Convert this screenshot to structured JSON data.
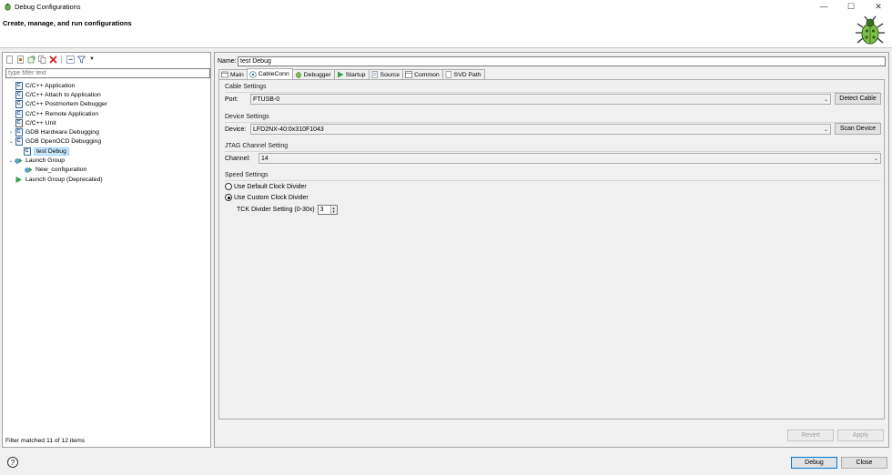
{
  "window": {
    "title": "Debug Configurations",
    "minimize": "—",
    "maximize": "☐",
    "close": "✕"
  },
  "header": {
    "subtitle": "Create, manage, and run configurations",
    "icon": "bug-icon"
  },
  "left": {
    "filter_placeholder": "type filter text",
    "tree": [
      {
        "label": "C/C++ Application",
        "icon": "c-app-icon",
        "level": 0
      },
      {
        "label": "C/C++ Attach to Application",
        "icon": "c-app-icon",
        "level": 0
      },
      {
        "label": "C/C++ Postmortem Debugger",
        "icon": "c-app-icon",
        "level": 0
      },
      {
        "label": "C/C++ Remote Application",
        "icon": "c-app-icon",
        "level": 0
      },
      {
        "label": "C/C++ Unit",
        "icon": "c-unit-icon",
        "level": 0
      },
      {
        "label": "GDB Hardware Debugging",
        "icon": "c-app-icon",
        "level": 0
      },
      {
        "label": "GDB OpenOCD Debugging",
        "icon": "c-app-icon",
        "level": 0
      },
      {
        "label": "test Debug",
        "icon": "c-app-icon",
        "level": 1
      },
      {
        "label": "Launch Group",
        "icon": "launch-group-icon",
        "level": 0
      },
      {
        "label": "New_configuration",
        "icon": "launch-config-icon",
        "level": 1
      },
      {
        "label": "Launch Group (Deprecated)",
        "icon": "run-icon",
        "level": 0
      }
    ],
    "status": "Filter matched 11 of 12 items"
  },
  "right": {
    "name_label": "Name:",
    "name_value": "test Debug",
    "tabs": [
      {
        "label": "Main",
        "icon": "main-tab-icon"
      },
      {
        "label": "CableConn",
        "icon": "cable-tab-icon"
      },
      {
        "label": "Debugger",
        "icon": "debugger-tab-icon"
      },
      {
        "label": "Startup",
        "icon": "startup-tab-icon"
      },
      {
        "label": "Source",
        "icon": "source-tab-icon"
      },
      {
        "label": "Common",
        "icon": "common-tab-icon"
      },
      {
        "label": "SVD Path",
        "icon": "svd-tab-icon"
      }
    ],
    "active_tab": "CableConn",
    "cable": {
      "group": "Cable Settings",
      "port_label": "Port:",
      "port_value": "FTUSB-0",
      "detect_button": "Detect Cable"
    },
    "device": {
      "group": "Device Settings",
      "device_label": "Device:",
      "device_value": "LFD2NX-40:0x310F1043",
      "scan_button": "Scan Device"
    },
    "jtag": {
      "group": "JTAG Channel Setting",
      "channel_label": "Channel:",
      "channel_value": "14"
    },
    "speed": {
      "group": "Speed Settings",
      "default_label": "Use Default Clock Divider",
      "custom_label": "Use Custom Clock Divider",
      "selected": "custom",
      "tck_label": "TCK Divider Setting (0-30x)",
      "tck_value": "3"
    },
    "revert_button": "Revert",
    "apply_button": "Apply"
  },
  "footer": {
    "help": "?",
    "debug_button": "Debug",
    "close_button": "Close"
  }
}
